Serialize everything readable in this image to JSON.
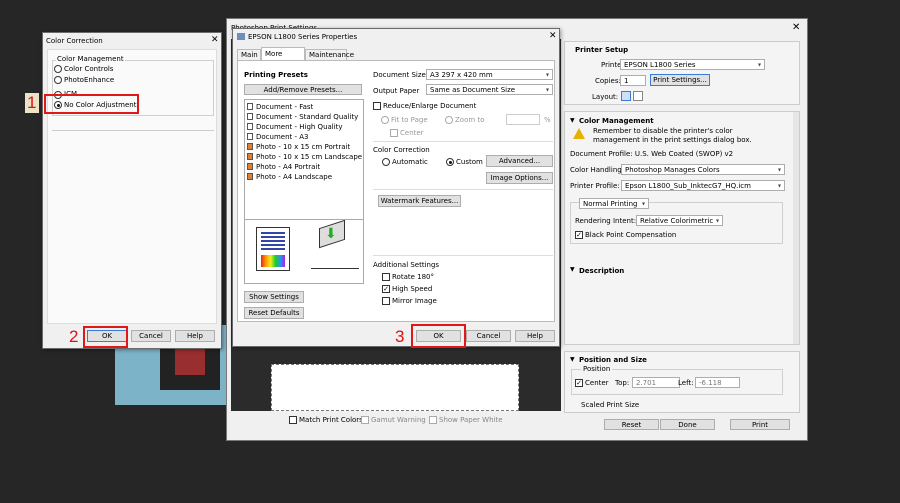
{
  "photoshop": {
    "title": "Photoshop Print Settings",
    "close": "✕",
    "printer_setup_heading": "Printer Setup",
    "printer_label": "Printer:",
    "printer_value": "EPSON L1800 Series",
    "copies_label": "Copies:",
    "copies_value": "1",
    "print_settings_button": "Print Settings...",
    "layout_label": "Layout:",
    "color_mgmt_heading": "Color Management",
    "color_mgmt_note": "Remember to disable the printer's color management in the print settings dialog box.",
    "document_profile": "Document Profile: U.S. Web Coated (SWOP) v2",
    "color_handling_label": "Color Handling:",
    "color_handling_value": "Photoshop Manages Colors",
    "printer_profile_label": "Printer Profile:",
    "printer_profile_value": "Epson L1800_Sub_InktecG7_HQ.icm",
    "normal_printing_value": "Normal Printing",
    "rendering_intent_label": "Rendering Intent:",
    "rendering_intent_value": "Relative Colorimetric",
    "black_point_label": "Black Point Compensation",
    "description_heading": "Description",
    "position_size_heading": "Position and Size",
    "position_label": "Position",
    "center_label": "Center",
    "top_label": "Top:",
    "top_value": "2.701",
    "left_label": "Left:",
    "left_value": "-6.118",
    "scaled_print_size_label": "Scaled Print Size",
    "match_print_colors": "Match Print Colors",
    "gamut_warning": "Gamut Warning",
    "show_paper_white": "Show Paper White",
    "reset_button": "Reset",
    "done_button": "Done",
    "print_button": "Print"
  },
  "epson": {
    "title": "EPSON L1800 Series Properties",
    "close": "✕",
    "tabs": [
      "Main",
      "More Options",
      "Maintenance"
    ],
    "printing_presets_heading": "Printing Presets",
    "add_remove_button": "Add/Remove Presets...",
    "presets": [
      "Document - Fast",
      "Document - Standard Quality",
      "Document - High Quality",
      "Document - A3",
      "Photo - 10 x 15 cm Portrait",
      "Photo - 10 x 15 cm Landscape",
      "Photo - A4 Portrait",
      "Photo - A4 Landscape"
    ],
    "show_settings_button": "Show Settings",
    "reset_defaults_button": "Reset Defaults",
    "document_size_label": "Document Size",
    "document_size_value": "A3 297 x 420 mm",
    "output_paper_label": "Output Paper",
    "output_paper_value": "Same as Document Size",
    "reduce_enlarge_label": "Reduce/Enlarge Document",
    "fit_to_page_label": "Fit to Page",
    "zoom_to_label": "Zoom to",
    "percent_sign": "%",
    "center_label": "Center",
    "color_correction_heading": "Color Correction",
    "automatic_label": "Automatic",
    "custom_label": "Custom",
    "advanced_button": "Advanced...",
    "image_options_button": "Image Options...",
    "watermark_button": "Watermark Features...",
    "additional_settings_heading": "Additional Settings",
    "rotate_label": "Rotate 180°",
    "high_speed_label": "High Speed",
    "mirror_image_label": "Mirror Image",
    "ok_button": "OK",
    "cancel_button": "Cancel",
    "help_button": "Help"
  },
  "color_correction": {
    "title": "Color Correction",
    "close": "✕",
    "group_label": "Color Management",
    "options": [
      "Color Controls",
      "PhotoEnhance",
      "ICM",
      "No Color Adjustment"
    ],
    "ok_button": "OK",
    "cancel_button": "Cancel",
    "help_button": "Help"
  },
  "callouts": [
    "1",
    "2",
    "3"
  ],
  "colors": {
    "accent_red": "#e01818",
    "dialog_bg": "#f0f0f0",
    "dark_bg": "#262626"
  }
}
